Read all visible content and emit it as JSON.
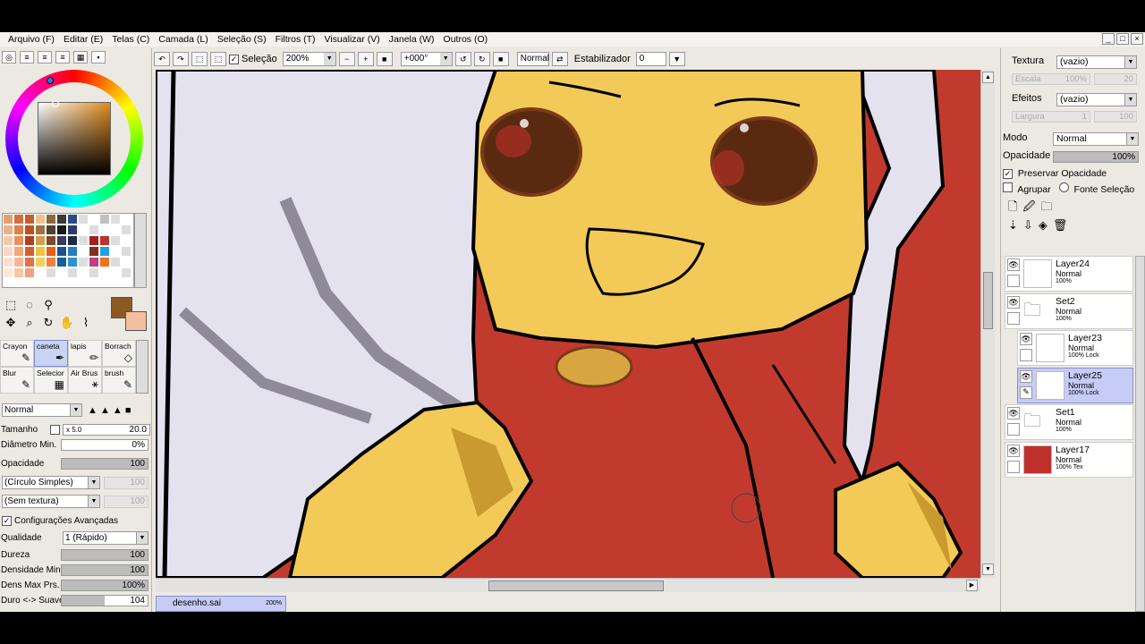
{
  "menu": [
    "Arquivo (F)",
    "Editar (E)",
    "Telas (C)",
    "Camada (L)",
    "Seleção (S)",
    "Filtros (T)",
    "Visualizar (V)",
    "Janela (W)",
    "Outros (O)"
  ],
  "toolbar": {
    "selection_label": "Seleção",
    "zoom": "200%",
    "rotation": "+000°",
    "blend": "Normal",
    "stabilizer_label": "Estabilizador",
    "stabilizer_value": "0"
  },
  "brushes": [
    "Crayon",
    "caneta",
    "lapis",
    "Borrach",
    "Blur",
    "Selecior",
    "Air Brus",
    "brush"
  ],
  "brush_settings": {
    "mode": "Normal",
    "size_label": "Tamanho",
    "size_mult": "x 5.0",
    "size_value": "20.0",
    "min_diam_label": "Diâmetro Min.",
    "min_diam_value": "0%",
    "opacity_label": "Opacidade",
    "opacity_value": "100",
    "shape": "(Círculo Simples)",
    "shape_value": "100",
    "texture": "(Sem textura)",
    "texture_value": "100",
    "advanced_label": "Configurações Avançadas",
    "quality_label": "Qualidade",
    "quality_value": "1 (Rápido)",
    "hardness_label": "Dureza",
    "hardness_value": "100",
    "min_density_label": "Densidade Min.",
    "min_density_value": "100",
    "max_density_label": "Dens Max Prs.",
    "max_density_value": "100%",
    "soft_hard_label": "Duro <-> Suave",
    "soft_hard_value": "104"
  },
  "right_panel": {
    "texture_label": "Textura",
    "texture_value": "(vazio)",
    "scale_label": "Escala",
    "scale_value": "100%",
    "scale_num": "20",
    "effects_label": "Efeitos",
    "effects_value": "(vazio)",
    "width_label": "Largura",
    "width_value": "1",
    "width_num": "100",
    "mode_label": "Modo",
    "mode_value": "Normal",
    "opacity_label": "Opacidade",
    "opacity_value": "100%",
    "preserve_label": "Preservar Opacidade",
    "group_label": "Agrupar",
    "source_label": "Fonte Seleção"
  },
  "layers": [
    {
      "name": "Layer24",
      "mode": "Normal",
      "opacity": "100%",
      "indent": false,
      "active": false,
      "type": "layer",
      "thumb": "#ffffff"
    },
    {
      "name": "Set2",
      "mode": "Normal",
      "opacity": "100%",
      "indent": false,
      "active": false,
      "type": "folder",
      "thumb": "#ffffff"
    },
    {
      "name": "Layer23",
      "mode": "Normal",
      "opacity": "100% Lock",
      "indent": true,
      "active": false,
      "type": "layer",
      "thumb": "#ffffff"
    },
    {
      "name": "Layer25",
      "mode": "Normal",
      "opacity": "100% Lock",
      "indent": true,
      "active": true,
      "type": "layer",
      "thumb": "#ffffff"
    },
    {
      "name": "Set1",
      "mode": "Normal",
      "opacity": "100%",
      "indent": false,
      "active": false,
      "type": "folder",
      "thumb": "#ffffff"
    },
    {
      "name": "Layer17",
      "mode": "Normal",
      "opacity": "100% Tex",
      "indent": false,
      "active": false,
      "type": "layer",
      "thumb": "#c0302a"
    }
  ],
  "document": {
    "name": "desenho.sai",
    "zoom": "200%"
  },
  "colors": {
    "foreground": "#8a5a22",
    "background": "#f2c0a0",
    "canvas_bg": "#c23a2e",
    "skin": "#f3c957",
    "hood": "#e2e0ec",
    "eye": "#5a2a10"
  }
}
